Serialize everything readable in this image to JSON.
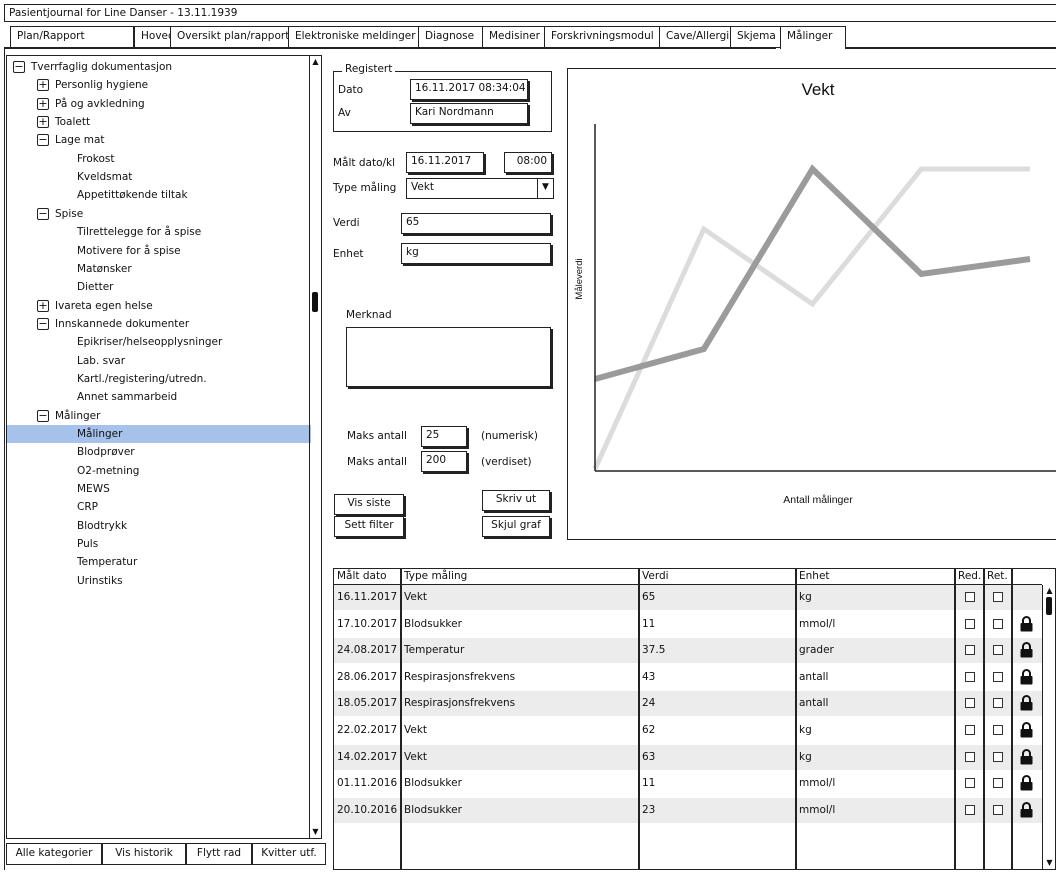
{
  "window": {
    "title": "Pasientjournal for Line Danser - 13.11.1939"
  },
  "tabs": [
    "Plan/Rapport",
    "Hovedkort",
    "Oversikt plan/rapport",
    "Elektroniske meldinger",
    "Diagnose",
    "Medisiner",
    "Forskrivningsmodul",
    "Cave/Allergi",
    "Skjema",
    "Målinger"
  ],
  "tree": [
    "Tverrfaglig dokumentasjon",
    "Personlig hygiene",
    "På og avkledning",
    "Toalett",
    "Lage mat",
    "Frokost",
    "Kveldsmat",
    "Appetittøkende tiltak",
    "Spise",
    "Tilrettelegge for å spise",
    "Motivere for å spise",
    "Matønsker",
    "Dietter",
    "Ivareta egen helse",
    "Innskannede dokumenter",
    "Epikriser/helseopplysninger",
    "Lab. svar",
    "Kartl./registering/utredn.",
    "Annet sammarbeid",
    "Målinger",
    "Målinger",
    "Blodprøver",
    "O2-metning",
    "MEWS",
    "CRP",
    "Blodtrykk",
    "Puls",
    "Temperatur",
    "Urinstiks"
  ],
  "bottom_buttons": [
    "Alle kategorier",
    "Vis historik",
    "Flytt rad",
    "Kvitter utf."
  ],
  "form": {
    "registered_group": "Registert",
    "dato_label": "Dato",
    "dato_value": "16.11.2017 08:34:04",
    "av_label": "Av",
    "av_value": "Kari Nordmann",
    "malt_label": "Målt dato/kl",
    "malt_date": "16.11.2017",
    "malt_time": "08:00",
    "type_label": "Type måling",
    "type_value": "Vekt",
    "verdi_label": "Verdi",
    "verdi_value": "65",
    "enhet_label": "Enhet",
    "enhet_value": "kg",
    "merknad_label": "Merknad",
    "merknad_value": "",
    "maks1_label": "Maks antall",
    "maks1_value": "25",
    "maks1_hint": "(numerisk)",
    "maks2_label": "Maks antall",
    "maks2_value": "200",
    "maks2_hint": "(verdiset)",
    "btn_vis_siste": "Vis siste",
    "btn_skriv_ut": "Skriv ut",
    "btn_sett_filter": "Sett filter",
    "btn_skjul_graf": "Skjul graf"
  },
  "chart_data": {
    "type": "line",
    "title": "Vekt",
    "xlabel": "Antall målinger",
    "ylabel": "Måleverdi",
    "x": [
      0,
      1,
      2,
      3,
      4
    ],
    "series": [
      {
        "values": [
          30,
          40,
          100,
          65,
          70
        ],
        "color": "#9b9b9b",
        "opacity": 1
      },
      {
        "values": [
          0,
          80,
          55,
          100,
          100
        ],
        "color": "#dcdcdc",
        "opacity": 1
      }
    ]
  },
  "table": {
    "headers": [
      "Målt dato",
      "Type måling",
      "Verdi",
      "Enhet",
      "Red.",
      "Ret."
    ],
    "rows": [
      {
        "date": "16.11.2017",
        "type": "Vekt",
        "value": "65",
        "unit": "kg",
        "locked": false
      },
      {
        "date": "17.10.2017",
        "type": "Blodsukker",
        "value": "11",
        "unit": "mmol/l",
        "locked": true
      },
      {
        "date": "24.08.2017",
        "type": "Temperatur",
        "value": "37.5",
        "unit": "grader",
        "locked": true
      },
      {
        "date": "28.06.2017",
        "type": "Respirasjonsfrekvens",
        "value": "43",
        "unit": "antall",
        "locked": true
      },
      {
        "date": "18.05.2017",
        "type": "Respirasjonsfrekvens",
        "value": "24",
        "unit": "antall",
        "locked": true
      },
      {
        "date": "22.02.2017",
        "type": "Vekt",
        "value": "62",
        "unit": "kg",
        "locked": true
      },
      {
        "date": "14.02.2017",
        "type": "Vekt",
        "value": "63",
        "unit": "kg",
        "locked": true
      },
      {
        "date": "01.11.2016",
        "type": "Blodsukker",
        "value": "11",
        "unit": "mmol/l",
        "locked": true
      },
      {
        "date": "20.10.2016",
        "type": "Blodsukker",
        "value": "23",
        "unit": "mmol/l",
        "locked": true
      }
    ]
  }
}
